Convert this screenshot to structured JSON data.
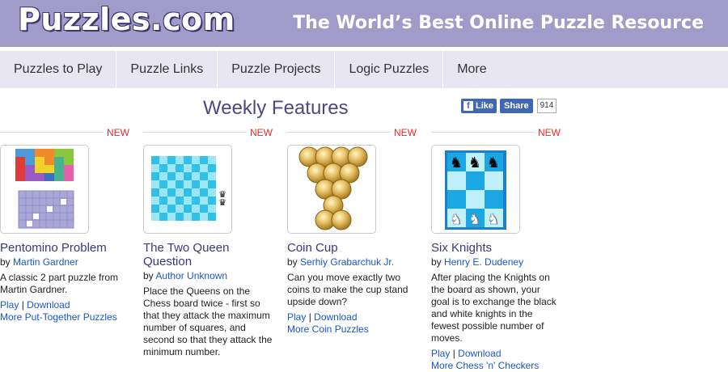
{
  "header": {
    "logo": "Puzzles.com",
    "tagline": "The World’s Best Online Puzzle Resource"
  },
  "nav": {
    "items": [
      "Puzzles to Play",
      "Puzzle Links",
      "Puzzle Projects",
      "Logic Puzzles",
      "More"
    ]
  },
  "section": {
    "title": "Weekly Features"
  },
  "social": {
    "like": "Like",
    "share": "Share",
    "count": "914"
  },
  "cards": [
    {
      "badge": "NEW",
      "title": "Pentomino Problem",
      "by": "by",
      "author": "Martin Gardner",
      "desc": "A classic 2 part puzzle from Martin Gardner.",
      "play": "Play",
      "sep": "|",
      "download": "Download",
      "more": "More Put-Together Puzzles"
    },
    {
      "badge": "NEW",
      "title": "The Two Queen Question",
      "by": "by",
      "author": "Author Unknown",
      "desc": "Place the Queens on the Chess board twice - first so that they attack the maximum number of squares, and second so that they attack the minimum number.",
      "play": "",
      "sep": "",
      "download": "",
      "more": ""
    },
    {
      "badge": "NEW",
      "title": "Coin Cup",
      "by": "by",
      "author": "Serhiy Grabarchuk Jr.",
      "desc": "Can you move exactly two coins to make the cup stand upside down?",
      "play": "Play",
      "sep": "|",
      "download": "Download",
      "more": "More Coin Puzzles"
    },
    {
      "badge": "NEW",
      "title": "Six Knights",
      "by": "by",
      "author": "Henry E. Dudeney",
      "desc": "After placing the Knights on the board as shown, your goal is to exchange the black and white knights in the fewest possible number of moves.",
      "play": "Play",
      "sep": "|",
      "download": "Download",
      "more": "More Chess 'n' Checkers"
    }
  ],
  "colors": {
    "header_bg": "#a19bc9",
    "nav_bg": "#e8e6f2",
    "title": "#4d4787",
    "link": "#1a56c8",
    "new_badge": "#e52a2a"
  }
}
